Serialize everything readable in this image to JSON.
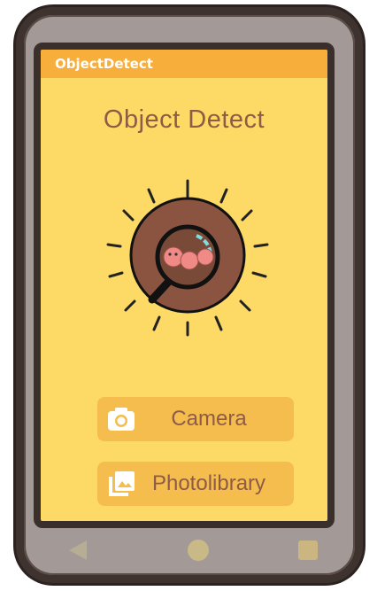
{
  "appbar": {
    "title": "ObjectDetect"
  },
  "main": {
    "heading": "Object Detect",
    "buttons": [
      {
        "label": "Camera",
        "icon": "camera-icon"
      },
      {
        "label": "Photolibrary",
        "icon": "photo-library-icon"
      }
    ]
  },
  "navbar": {
    "icons": [
      "back-icon",
      "home-icon",
      "recents-icon"
    ]
  },
  "colors": {
    "background": "#fdd966",
    "appbar": "#f7ae3b",
    "button": "#f4bd4e",
    "text": "#8e5b46",
    "phone_frame": "#a39a97"
  }
}
